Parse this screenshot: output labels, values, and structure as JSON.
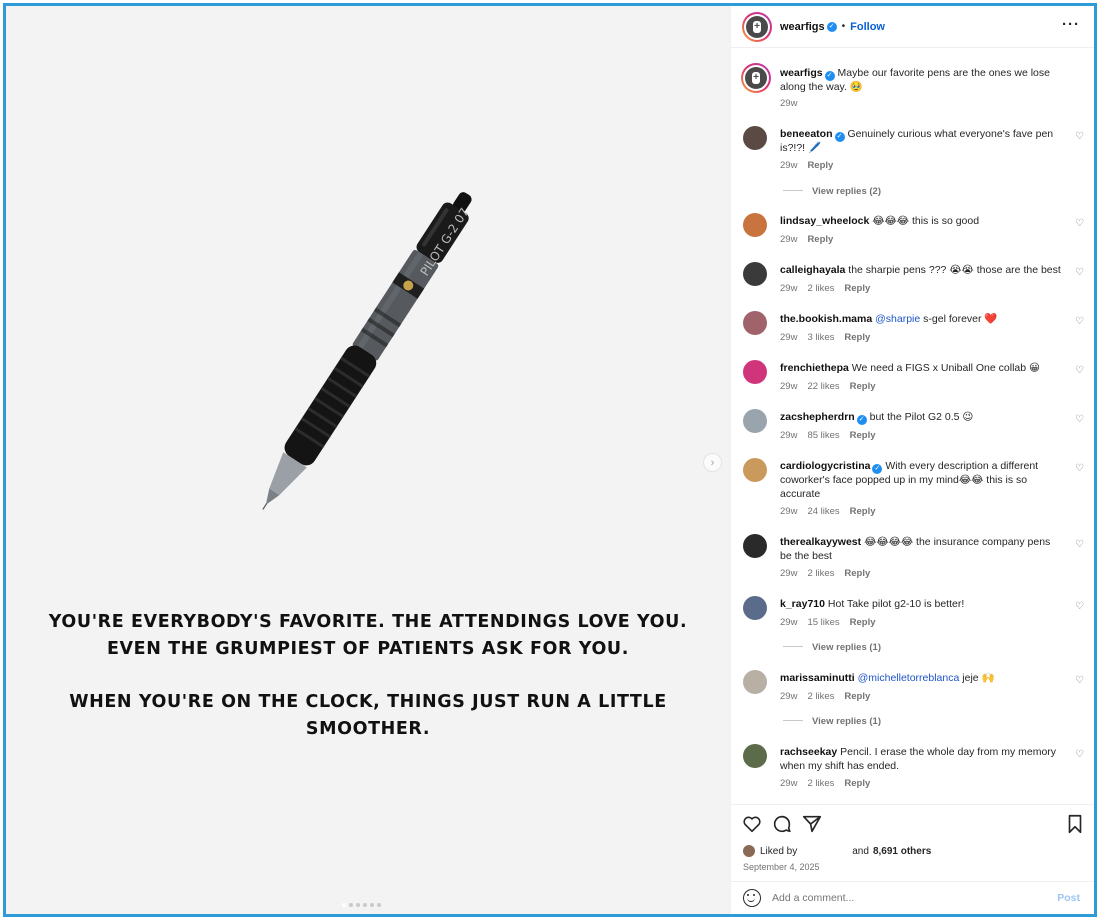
{
  "post": {
    "username": "wearfigs",
    "follow_label": "Follow",
    "separator": "•",
    "more_icon": "more-horizontal-icon",
    "caption_text": "Maybe our favorite pens are the ones we lose along the way. 🥹",
    "caption_time": "29w"
  },
  "media": {
    "pen_label": "PILOT G-2 07",
    "caption_line1": "YOU'RE EVERYBODY'S FAVORITE. THE ATTENDINGS LOVE YOU. EVEN THE GRUMPIEST OF PATIENTS ASK FOR YOU.",
    "caption_line2": "WHEN YOU'RE ON THE CLOCK, THINGS JUST RUN A LITTLE SMOOTHER.",
    "next_icon": "chevron-right-icon",
    "dots_count": 6,
    "active_dot": 1
  },
  "comments": [
    {
      "user": "beneeaton",
      "verified": true,
      "text": "Genuinely curious what everyone's fave pen is?!?! 🖊️",
      "time": "29w",
      "likes": "",
      "reply": "Reply",
      "view_replies": "View replies (2)",
      "avatar_color": "#5b4a44"
    },
    {
      "user": "lindsay_wheelock",
      "verified": false,
      "text": "😂😂😂 this is so good",
      "time": "29w",
      "likes": "",
      "reply": "Reply",
      "view_replies": "",
      "avatar_color": "#c9743e"
    },
    {
      "user": "calleighayala",
      "verified": false,
      "text": "the sharpie pens ??? 😭😭 those are the best",
      "time": "29w",
      "likes": "2 likes",
      "reply": "Reply",
      "view_replies": "",
      "avatar_color": "#3a3a3a"
    },
    {
      "user": "the.bookish.mama",
      "verified": false,
      "mention": "@sharpie",
      "text": "s-gel forever ❤️",
      "time": "29w",
      "likes": "3 likes",
      "reply": "Reply",
      "view_replies": "",
      "avatar_color": "#a0636b"
    },
    {
      "user": "frenchiethepa",
      "verified": false,
      "text": "We need a FIGS x Uniball One collab 😀",
      "time": "29w",
      "likes": "22 likes",
      "reply": "Reply",
      "view_replies": "",
      "avatar_color": "#d0357c"
    },
    {
      "user": "zacshepherdrn",
      "verified": true,
      "text": "but the Pilot G2 0.5 😉",
      "time": "29w",
      "likes": "85 likes",
      "reply": "Reply",
      "view_replies": "",
      "avatar_color": "#9aa4ad"
    },
    {
      "user": "cardiologycristina",
      "verified": true,
      "text": "With every description a different coworker's face popped up in my mind😂😂 this is so accurate",
      "time": "29w",
      "likes": "24 likes",
      "reply": "Reply",
      "view_replies": "",
      "avatar_color": "#c99a5b"
    },
    {
      "user": "therealkayywest",
      "verified": false,
      "text": "😂😂😂😂 the insurance company pens be the best",
      "time": "29w",
      "likes": "2 likes",
      "reply": "Reply",
      "view_replies": "",
      "avatar_color": "#2a2a2a"
    },
    {
      "user": "k_ray710",
      "verified": false,
      "text": "Hot Take pilot g2-10 is better!",
      "time": "29w",
      "likes": "15 likes",
      "reply": "Reply",
      "view_replies": "View replies (1)",
      "avatar_color": "#5b6b8a"
    },
    {
      "user": "marissaminutti",
      "verified": false,
      "mention": "@michelletorreblanca",
      "text": "jeje 🙌",
      "time": "29w",
      "likes": "2 likes",
      "reply": "Reply",
      "view_replies": "View replies (1)",
      "avatar_color": "#b8b0a4"
    },
    {
      "user": "rachseekay",
      "verified": false,
      "text": "Pencil. I erase the whole day from my memory when my shift has ended.",
      "time": "29w",
      "likes": "2 likes",
      "reply": "Reply",
      "view_replies": "",
      "avatar_color": "#5c6b4a"
    }
  ],
  "actions": {
    "like_icon": "heart-icon",
    "comment_icon": "comment-icon",
    "share_icon": "send-icon",
    "save_icon": "bookmark-icon"
  },
  "likes_line": {
    "liked_by": "Liked by",
    "and_text": "and",
    "others": "8,691 others"
  },
  "date": "September 4, 2025",
  "add_comment": {
    "placeholder": "Add a comment...",
    "post_label": "Post",
    "emoji_icon": "emoji-icon"
  }
}
